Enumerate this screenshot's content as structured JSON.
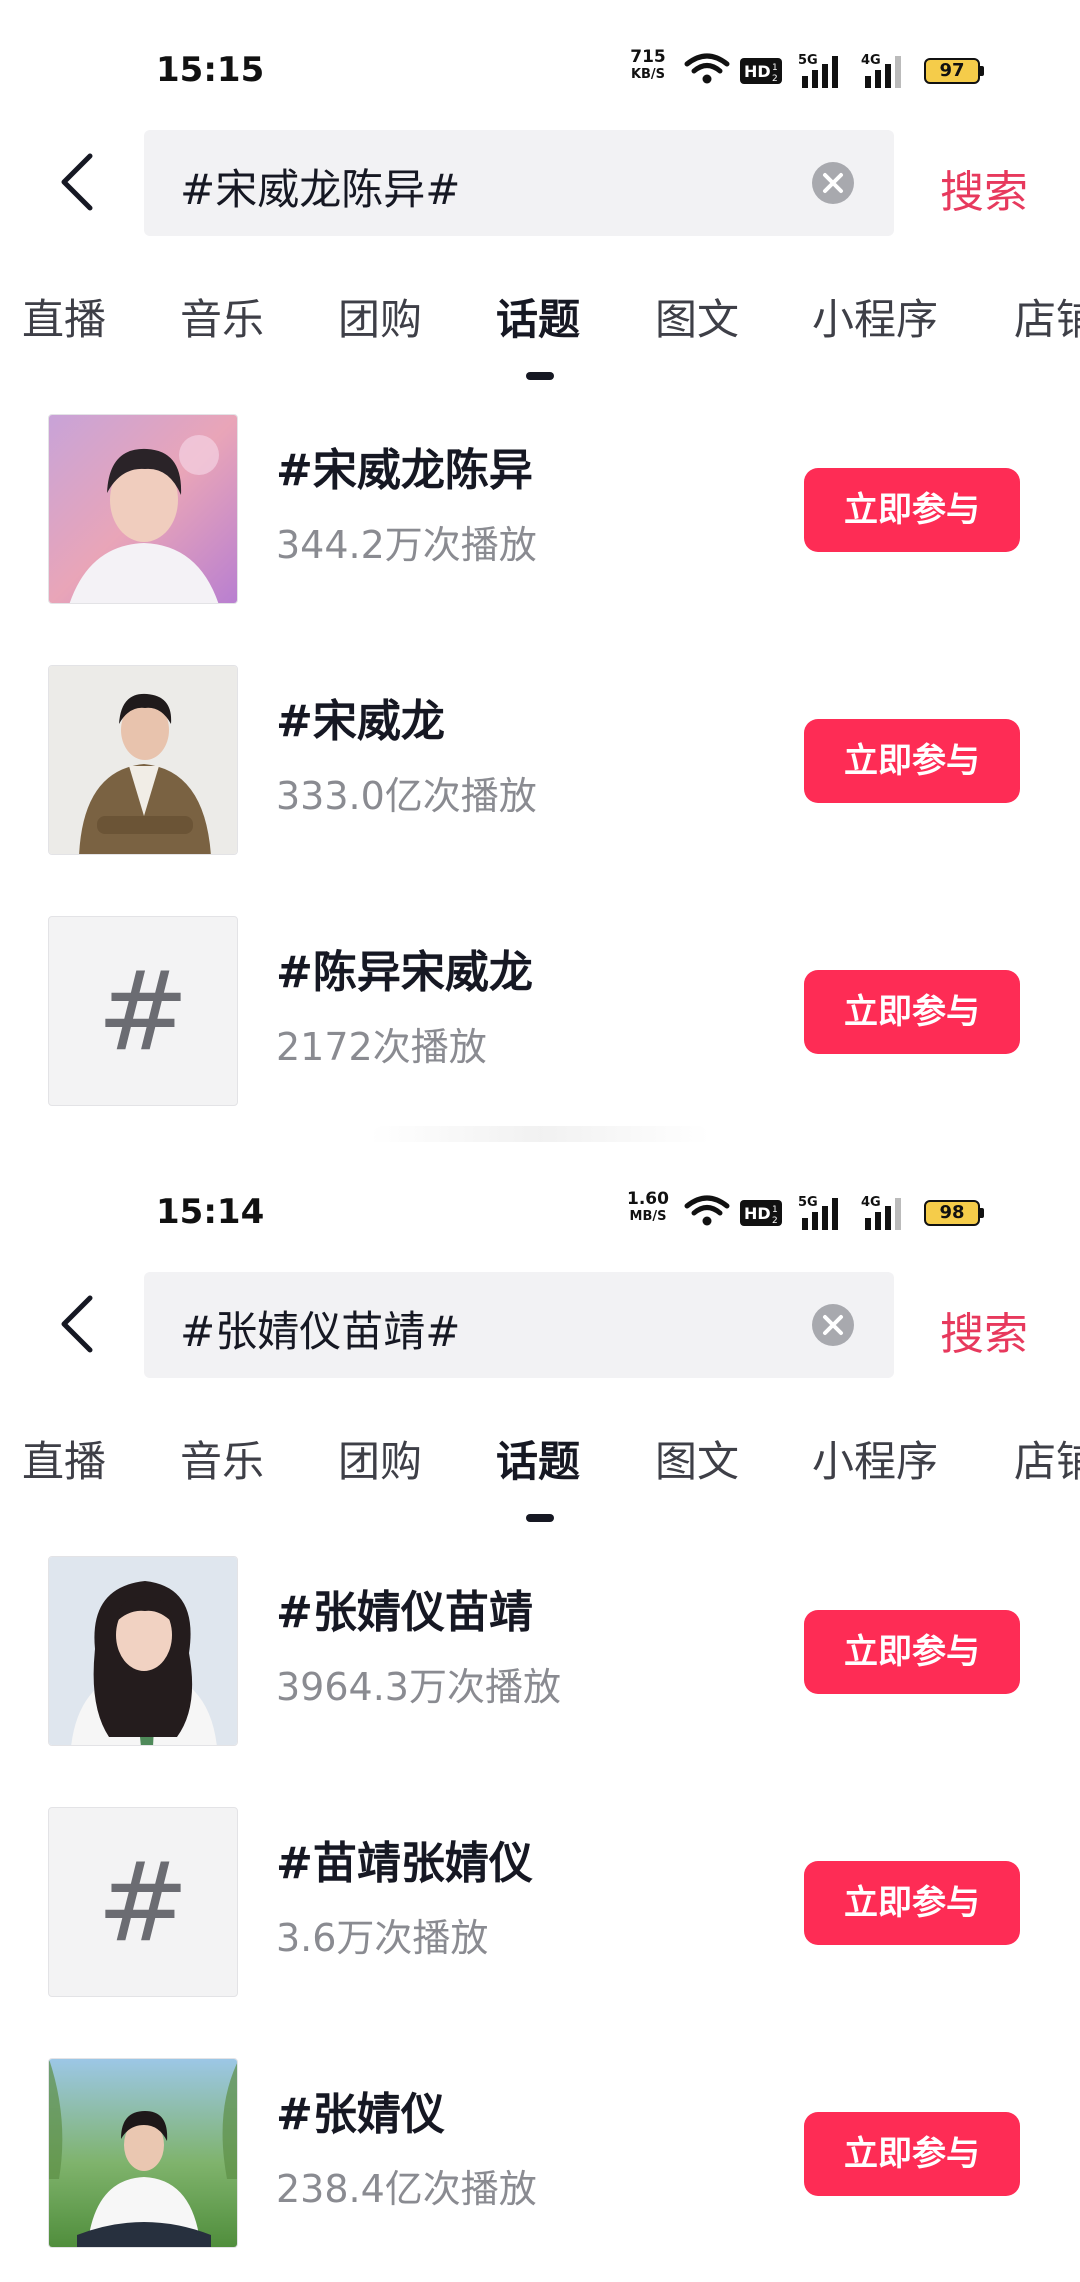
{
  "screens": [
    {
      "status": {
        "time": "15:15",
        "speed_value": "715",
        "speed_unit": "KB/S",
        "battery": "97"
      },
      "search": {
        "query": "#宋威龙陈异#",
        "button": "搜索"
      },
      "tabs": [
        "直播",
        "音乐",
        "团购",
        "话题",
        "图文",
        "小程序",
        "店铺"
      ],
      "active_tab": "话题",
      "results": [
        {
          "title": "#宋威龙陈异",
          "plays": "344.2万次播放",
          "action": "立即参与",
          "thumb": "photo"
        },
        {
          "title": "#宋威龙",
          "plays": "333.0亿次播放",
          "action": "立即参与",
          "thumb": "photo"
        },
        {
          "title": "#陈异宋威龙",
          "plays": "2172次播放",
          "action": "立即参与",
          "thumb": "hashtag-icon"
        }
      ]
    },
    {
      "status": {
        "time": "15:14",
        "speed_value": "1.60",
        "speed_unit": "MB/S",
        "battery": "98"
      },
      "search": {
        "query": "#张婧仪苗靖#",
        "button": "搜索"
      },
      "tabs": [
        "直播",
        "音乐",
        "团购",
        "话题",
        "图文",
        "小程序",
        "店铺"
      ],
      "active_tab": "话题",
      "results": [
        {
          "title": "#张婧仪苗靖",
          "plays": "3964.3万次播放",
          "action": "立即参与",
          "thumb": "photo"
        },
        {
          "title": "#苗靖张婧仪",
          "plays": "3.6万次播放",
          "action": "立即参与",
          "thumb": "hashtag-icon"
        },
        {
          "title": "#张婧仪",
          "plays": "238.4亿次播放",
          "action": "立即参与",
          "thumb": "photo"
        }
      ]
    }
  ],
  "hashtag_symbol": "#",
  "colors": {
    "accent": "#fe2c55",
    "search_button": "#e7395d",
    "battery": "#f5cc4a"
  }
}
